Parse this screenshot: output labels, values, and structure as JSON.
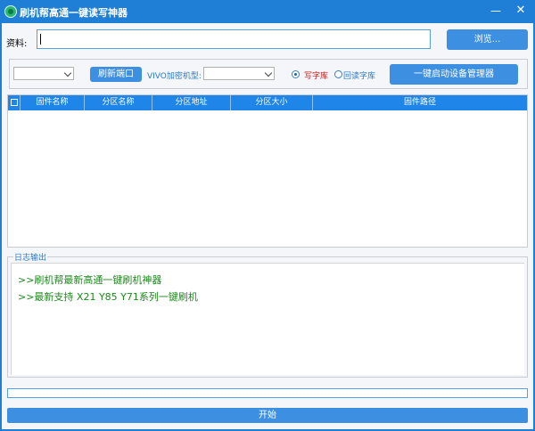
{
  "window": {
    "title": "刷机帮高通一键读写神器",
    "minimize_glyph": "—",
    "close_glyph": "✕",
    "icon": "app-logo-icon"
  },
  "file": {
    "label": "资料:",
    "value": "",
    "browse_label": "浏览..."
  },
  "toolbar": {
    "port_select_value": "",
    "refresh_label": "刷新端口",
    "vivo_label": "VIVO加密机型:",
    "vivo_select_value": "",
    "radio_write_label": "写字库",
    "radio_read_label": "回读字库",
    "selected_mode": "写字库",
    "devmgr_label": "一键启动设备管理器"
  },
  "table": {
    "columns": [
      "固件名称",
      "分区名称",
      "分区地址",
      "分区大小",
      "固件路径"
    ],
    "rows": []
  },
  "log": {
    "legend": "日志输出",
    "lines": [
      ">>刷机帮最新高通一键刷机神器",
      ">>最新支持 X21 Y85 Y71系列一键刷机"
    ]
  },
  "progress": {
    "value": 0
  },
  "start_label": "开始",
  "colors": {
    "titlebar": "#1f7ed5",
    "button": "#3d8fe1",
    "log_text": "#1a8a1a",
    "write_text": "#d21919"
  }
}
